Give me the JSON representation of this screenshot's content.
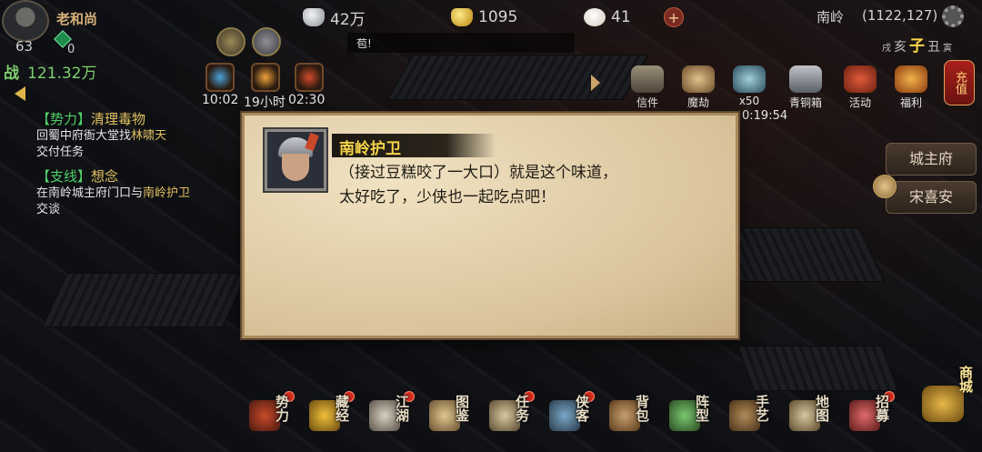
{
  "player": {
    "name": "老和尚",
    "level": "63",
    "jade": "0",
    "power_label": "战",
    "power": "121.32万"
  },
  "resources": {
    "silver": "42万",
    "gold": "1095",
    "bun": "41"
  },
  "location": {
    "name": "南岭",
    "coords": "(1122,127)"
  },
  "hours": {
    "left2": "戌",
    "left": "亥",
    "current": "子",
    "right": "丑",
    "right2": "寅"
  },
  "chat": {
    "text": "苞!"
  },
  "timers": {
    "t1": "10:02",
    "t2": "19小时",
    "t3": "02:30",
    "event": "0:19:54"
  },
  "quests": [
    {
      "tag": "【势力】",
      "name": "清理毒物",
      "desc_pre": "回蜀中府衙大堂找",
      "desc_hl": "林啸天",
      "desc_post": "交付任务"
    },
    {
      "tag": "【支线】",
      "name": "想念",
      "desc_pre": "在南岭城主府门口与",
      "desc_hl": "南岭护卫",
      "desc_post": "交谈"
    }
  ],
  "top_menu": {
    "letters": "信件",
    "demon": "魔劫",
    "bonus": "x50",
    "chest": "青铜箱",
    "activity": "活动",
    "welfare": "福利",
    "recharge": "充值"
  },
  "npcs": {
    "mansion": "城主府",
    "song": "宋喜安"
  },
  "dialog": {
    "speaker": "南岭护卫",
    "text": "（接过豆糕咬了一大口）就是这个味道，\n太好吃了，少侠也一起吃点吧！"
  },
  "bottom_menu": [
    "势力",
    "藏经",
    "江湖",
    "图鉴",
    "任务",
    "侠客",
    "背包",
    "阵型",
    "手艺",
    "地图",
    "招募"
  ],
  "shop": "商城",
  "colors": {
    "dialog_bg": "#e6d4ad",
    "speaker": "#f5d34a",
    "quest_tag": "#4fd06a",
    "highlight": "#e0c060"
  }
}
